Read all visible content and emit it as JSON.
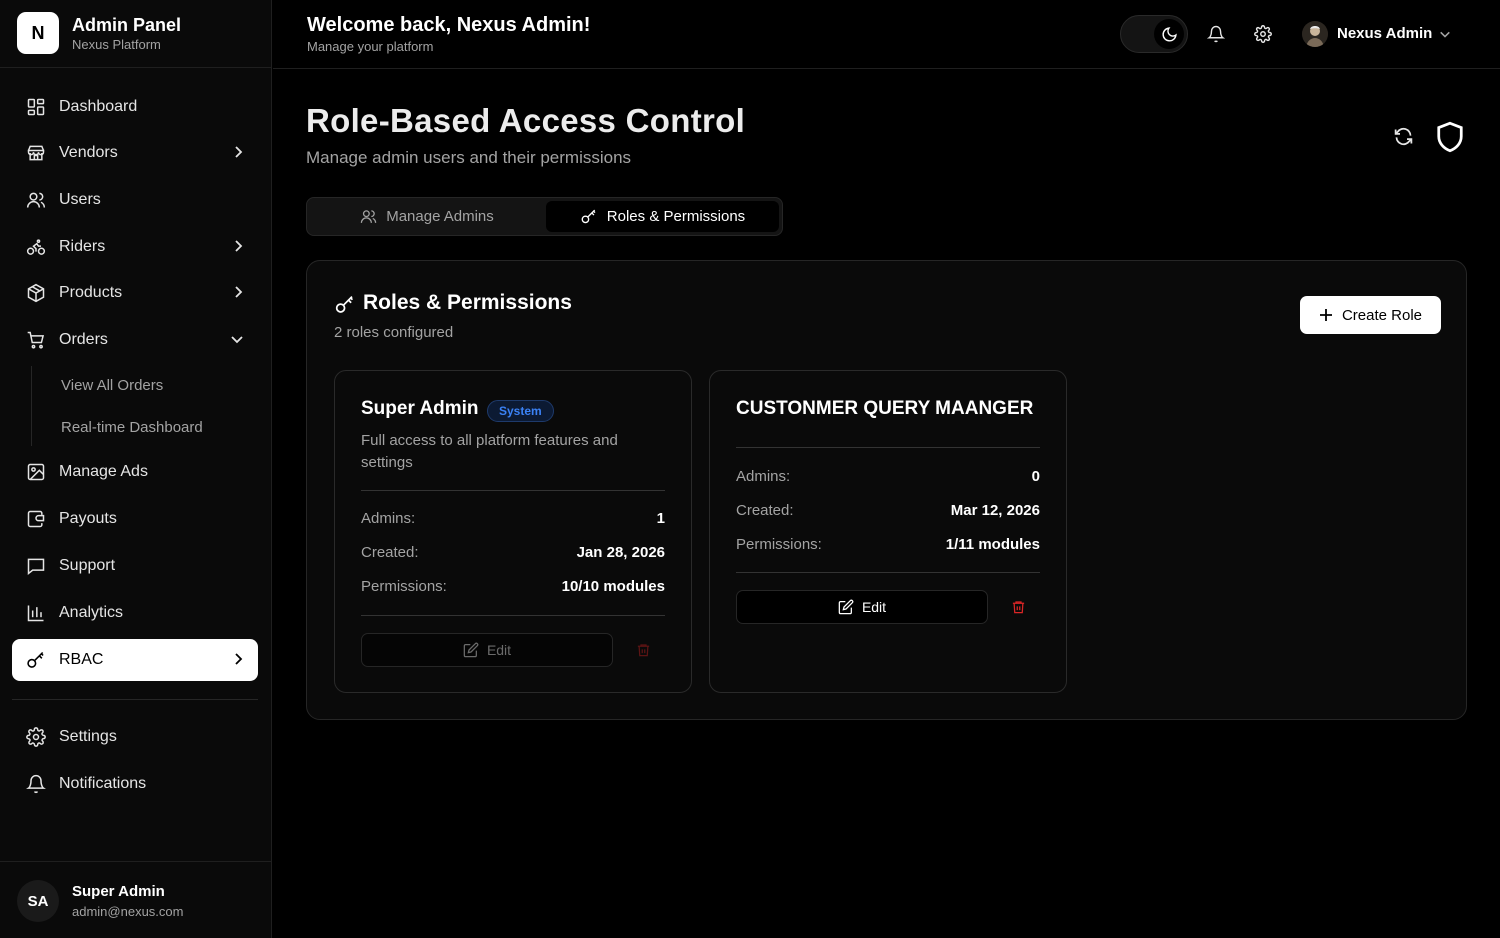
{
  "brand": {
    "logo_letter": "N",
    "title": "Admin Panel",
    "subtitle": "Nexus Platform"
  },
  "sidebar": {
    "items": [
      {
        "label": "Dashboard",
        "icon": "dashboard-icon"
      },
      {
        "label": "Vendors",
        "icon": "store-icon"
      },
      {
        "label": "Users",
        "icon": "users-icon"
      },
      {
        "label": "Riders",
        "icon": "bike-icon"
      },
      {
        "label": "Products",
        "icon": "box-icon"
      },
      {
        "label": "Orders",
        "icon": "cart-icon"
      },
      {
        "label": "Manage Ads",
        "icon": "image-icon"
      },
      {
        "label": "Payouts",
        "icon": "wallet-icon"
      },
      {
        "label": "Support",
        "icon": "message-icon"
      },
      {
        "label": "Analytics",
        "icon": "bar-chart-icon"
      },
      {
        "label": "RBAC",
        "icon": "key-icon"
      }
    ],
    "orders_sub": [
      "View All Orders",
      "Real-time Dashboard"
    ],
    "bottom_items": [
      {
        "label": "Settings",
        "icon": "gear-icon"
      },
      {
        "label": "Notifications",
        "icon": "bell-icon"
      }
    ],
    "user": {
      "initials": "SA",
      "name": "Super Admin",
      "email": "admin@nexus.com"
    }
  },
  "header": {
    "title": "Welcome back, Nexus Admin!",
    "subtitle": "Manage your platform",
    "profile_name": "Nexus Admin"
  },
  "page": {
    "title": "Role-Based Access Control",
    "subtitle": "Manage admin users and their permissions",
    "tabs": [
      {
        "label": "Manage Admins",
        "active": false
      },
      {
        "label": "Roles & Permissions",
        "active": true
      }
    ]
  },
  "panel": {
    "title": "Roles & Permissions",
    "subtitle": "2 roles configured",
    "create_label": "Create Role"
  },
  "roles": [
    {
      "name": "Super Admin",
      "badge": "System",
      "description": "Full access to all platform features and settings",
      "admins_label": "Admins:",
      "admins": "1",
      "created_label": "Created:",
      "created": "Jan 28, 2026",
      "permissions_label": "Permissions:",
      "permissions": "10/10 modules",
      "edit_label": "Edit"
    },
    {
      "name": "CUSTONMER QUERY MAANGER",
      "admins_label": "Admins:",
      "admins": "0",
      "created_label": "Created:",
      "created": "Mar 12, 2026",
      "permissions_label": "Permissions:",
      "permissions": "1/11 modules",
      "edit_label": "Edit"
    }
  ],
  "colors": {
    "accent_blue": "#3b82f6",
    "danger": "#dc2626",
    "background": "#000000",
    "active_nav": "#ffffff"
  }
}
